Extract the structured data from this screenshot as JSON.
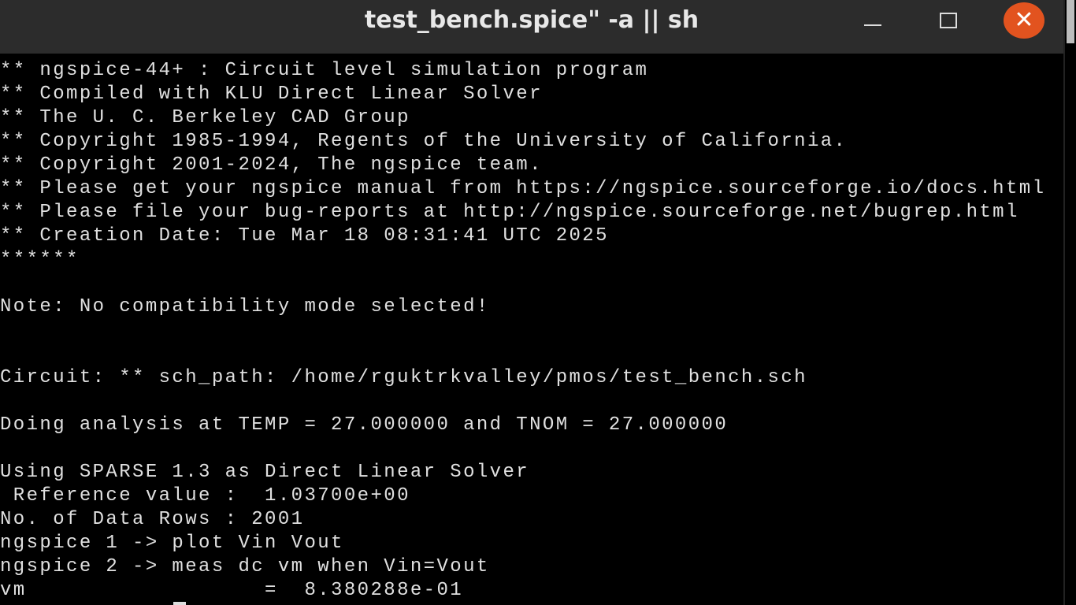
{
  "window": {
    "title": "test_bench.spice\" -a || sh",
    "close_label": "✕",
    "accent_close": "#e2531f"
  },
  "terminal": {
    "lines": [
      "** ngspice-44+ : Circuit level simulation program",
      "** Compiled with KLU Direct Linear Solver",
      "** The U. C. Berkeley CAD Group",
      "** Copyright 1985-1994, Regents of the University of California.",
      "** Copyright 2001-2024, The ngspice team.",
      "** Please get your ngspice manual from https://ngspice.sourceforge.io/docs.html",
      "** Please file your bug-reports at http://ngspice.sourceforge.net/bugrep.html",
      "** Creation Date: Tue Mar 18 08:31:41 UTC 2025",
      "******",
      "",
      "Note: No compatibility mode selected!",
      "",
      "",
      "Circuit: ** sch_path: /home/rguktrkvalley/pmos/test_bench.sch",
      "",
      "Doing analysis at TEMP = 27.000000 and TNOM = 27.000000",
      "",
      "Using SPARSE 1.3 as Direct Linear Solver",
      " Reference value :  1.03700e+00",
      "No. of Data Rows : 2001",
      "ngspice 1 -> plot Vin Vout",
      "ngspice 2 -> meas dc vm when Vin=Vout",
      "vm                  =  8.380288e-01"
    ]
  }
}
